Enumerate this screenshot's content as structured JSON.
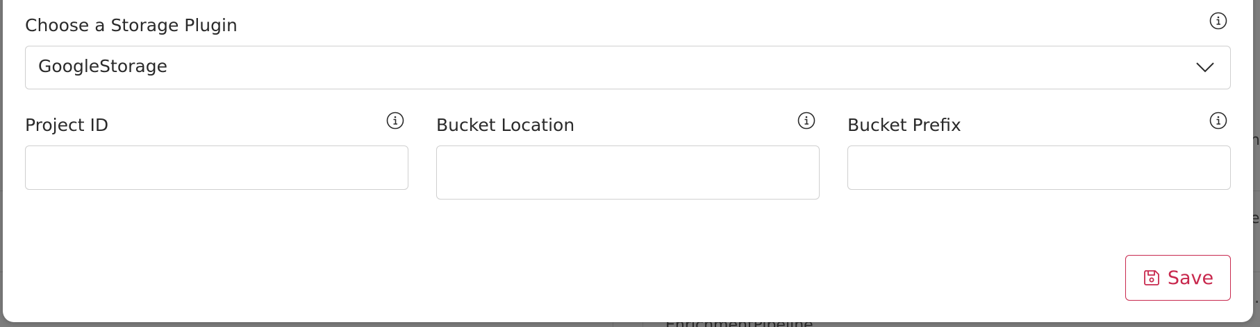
{
  "form": {
    "plugin_label": "Choose a Storage Plugin",
    "plugin_value": "GoogleStorage",
    "fields": [
      {
        "label": "Project ID",
        "value": ""
      },
      {
        "label": "Bucket Location",
        "value": ""
      },
      {
        "label": "Bucket Prefix",
        "value": ""
      }
    ],
    "save_label": "Save"
  },
  "background": {
    "partial_texts": [
      "n",
      "e",
      "i.",
      "EnrichmentPipeline"
    ]
  },
  "colors": {
    "accent": "#c8284d",
    "border": "#cfcfcf",
    "text": "#2a2a2a"
  },
  "icons": {
    "info": "info-icon",
    "chevron": "chevron-down-icon",
    "save": "floppy-disk-icon"
  }
}
